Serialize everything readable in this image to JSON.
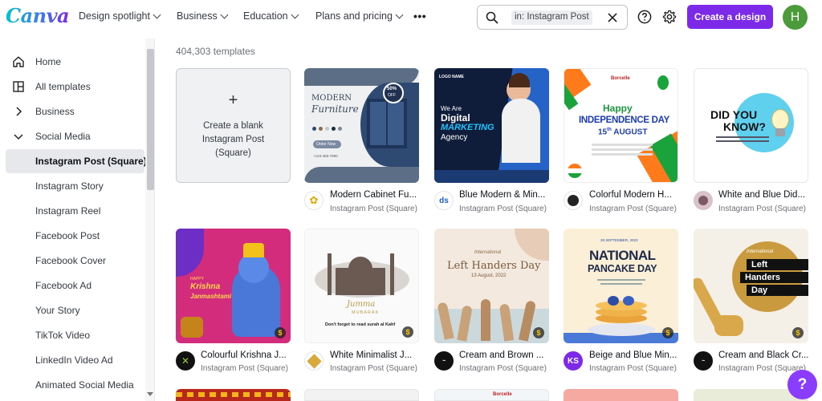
{
  "header": {
    "logo": "Canva",
    "nav": [
      {
        "label": "Design spotlight"
      },
      {
        "label": "Business"
      },
      {
        "label": "Education"
      },
      {
        "label": "Plans and pricing"
      }
    ],
    "more": "•••",
    "search": {
      "chip": "in: Instagram Post",
      "value": ""
    },
    "create_label": "Create a design",
    "avatar_initial": "H"
  },
  "sidebar": {
    "items": [
      {
        "label": "Home",
        "icon": "home-icon"
      },
      {
        "label": "All templates",
        "icon": "templates-icon"
      },
      {
        "label": "Business",
        "icon": "chevron-right-icon"
      },
      {
        "label": "Social Media",
        "icon": "chevron-down-icon"
      },
      {
        "label": "Instagram Post (Square)",
        "active": true
      },
      {
        "label": "Instagram Story"
      },
      {
        "label": "Instagram Reel"
      },
      {
        "label": "Facebook Post"
      },
      {
        "label": "Facebook Cover"
      },
      {
        "label": "Facebook Ad"
      },
      {
        "label": "Your Story"
      },
      {
        "label": "TikTok Video"
      },
      {
        "label": "LinkedIn Video Ad"
      },
      {
        "label": "Animated Social Media"
      }
    ]
  },
  "main": {
    "count": "404,303 templates",
    "blank": {
      "plus": "+",
      "text": "Create a blank Instagram Post (Square)"
    },
    "templates": [
      {
        "title": "Modern Cabinet Fu...",
        "subtitle": "Instagram Post (Square)"
      },
      {
        "title": "Blue Modern & Min...",
        "subtitle": "Instagram Post (Square)"
      },
      {
        "title": "Colorful Modern H...",
        "subtitle": "Instagram Post (Square)"
      },
      {
        "title": "White and Blue Did...",
        "subtitle": "Instagram Post (Square)"
      },
      {
        "title": "Colourful Krishna J...",
        "subtitle": "Instagram Post (Square)"
      },
      {
        "title": "White Minimalist J...",
        "subtitle": "Instagram Post (Square)"
      },
      {
        "title": "Cream and Brown ...",
        "subtitle": "Instagram Post (Square)"
      },
      {
        "title": "Beige and Blue Min...",
        "subtitle": "Instagram Post (Square)",
        "avatar_text": "KS"
      },
      {
        "title": "Cream and Black Cr...",
        "subtitle": "Instagram Post (Square)"
      }
    ],
    "thumbs": {
      "furniture": {
        "line1": "MODERN",
        "line2": "Furniture",
        "badge1": "50%",
        "badge2": "OFF",
        "cta": "Order Now",
        "phone": "+123-456-7890"
      },
      "marketing": {
        "logo": "LOGO NAME",
        "line1": "We Are",
        "line2": "Digital",
        "line3": "MARKETING",
        "line4": "Agency"
      },
      "independence": {
        "brand": "Borcelle",
        "line1": "Happy",
        "line2": "INDEPENDENCE DAY",
        "line3": "15",
        "line3b": "th",
        "line4": "AUGUST"
      },
      "didyouknow": {
        "line1": "DID YOU",
        "line2": "KNOW?"
      },
      "krishna": {
        "line1": "HAPPY",
        "line2": "Krishna",
        "line3": "Janmashtami"
      },
      "jumma": {
        "line1": "Jumma",
        "line2": "MUBARAK",
        "line3": "Don't forget to read surah al Kahf"
      },
      "lefthanders1": {
        "line1": "International",
        "line2": "Left Handers Day",
        "line3": "13 August, 2022"
      },
      "pancake": {
        "line0": "28 SEPTEMBER, 2023",
        "line1": "NATIONAL",
        "line2": "PANCAKE DAY"
      },
      "lefthanders2": {
        "line1": "International",
        "line2": "Left",
        "line3": "Handers",
        "line4": "Day"
      },
      "bottom_brand": "Borcelle"
    },
    "pro_symbol": "$",
    "help": "?"
  },
  "colors": {
    "accent": "#7d2ae8",
    "avatar": "#4c9b3b",
    "fab": "#8b3dff"
  }
}
